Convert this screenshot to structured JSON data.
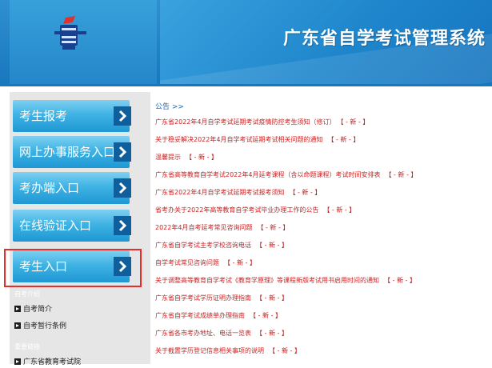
{
  "header": {
    "site_title": "广东省自学考试管理系统",
    "logo_icon": "exam-authority-logo"
  },
  "nav": [
    {
      "label": "考生报考"
    },
    {
      "label": "网上办事服务入口"
    },
    {
      "label": "考办端入口"
    },
    {
      "label": "在线验证入口"
    },
    {
      "label": "考生入口"
    }
  ],
  "sidebar_sections": {
    "intro": {
      "label": "自考介绍",
      "links": [
        "自考简介",
        "自考暂行条例"
      ]
    },
    "links_section": {
      "label": "重要链接",
      "links": [
        "广东省教育考试院"
      ]
    }
  },
  "notices": {
    "title": "公告 >>",
    "new_tag": "【 - 新 - 】",
    "items": [
      "广东省2022年4月自学考试延期考试疫情防控考生须知（修订）",
      "关于稳妥解决2022年4月自学考试延期考试相关问题的通知",
      "温馨提示",
      "广东省高等教育自学考试2022年4月延考课程（含以命题课程）考试时间安排表",
      "广东省2022年4月自学考试延期考试报考须知",
      "省考办关于2022年高等教育自学考试毕业办理工作的公告",
      "2022年4月自考延考常见咨询问题",
      "广东省自学考试主考学校咨询电话",
      "自学考试常见咨询问题",
      "关于调整高等教育自学考试《教育学原理》等课程新版考试用书启用时间的通知",
      "广东省自学考试学历证明办理指南",
      "广东省自学考试成绩单办理指南",
      "广东省各市考办地址、电话一览表",
      "关于截置学历登记信息相关事项的说明"
    ]
  },
  "colors": {
    "header_blue": "#1877bd",
    "button_cyan": "#3fb3e4",
    "notice_red": "#d02020",
    "highlight_red": "#e82b2b",
    "notice_title_blue": "#1a66b8"
  }
}
